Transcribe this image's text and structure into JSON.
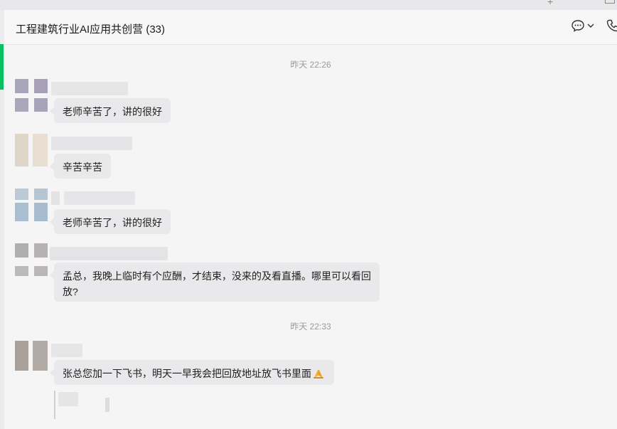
{
  "window": {
    "title": "工程建筑行业AI应用共创营 (33)"
  },
  "header_icons": [
    "chat-bubble-icon",
    "chevron-down-icon",
    "phone-icon"
  ],
  "colors": {
    "accent": "#07c160",
    "bubble": "#e9e9eb",
    "background": "#f5f5f5"
  },
  "messages": [
    {
      "type": "timestamp",
      "text": "昨天 22:26"
    },
    {
      "type": "message",
      "text": "老师辛苦了，讲的很好"
    },
    {
      "type": "message",
      "text": "辛苦辛苦"
    },
    {
      "type": "message",
      "text": "老师辛苦了，讲的很好"
    },
    {
      "type": "message",
      "line1": "孟总，我晚上临时有个应酬，才结束，没来的及看直播。哪里可以看回",
      "line2": "放?"
    },
    {
      "type": "timestamp",
      "text": "昨天 22:33"
    },
    {
      "type": "message",
      "text": "张总您加一下飞书，明天一早我会把回放地址放飞书里面",
      "emoji": "pray-emoji"
    }
  ]
}
